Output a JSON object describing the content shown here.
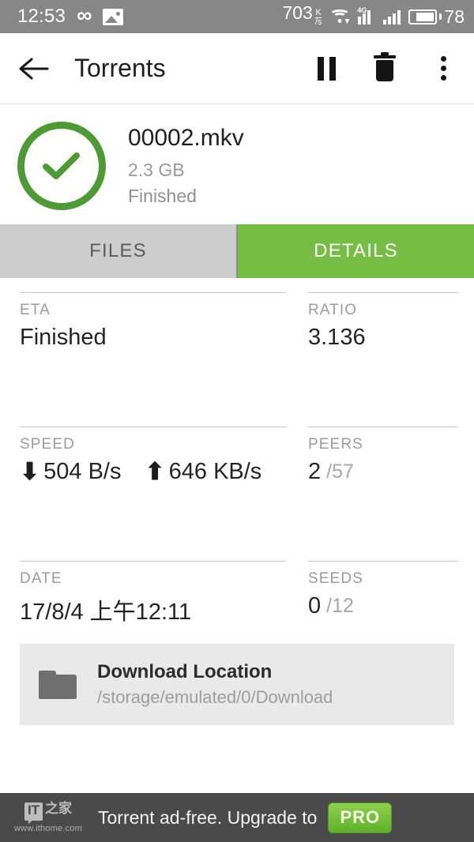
{
  "statusbar": {
    "time": "12:53",
    "infinity_icon": "infinity-icon",
    "image_icon": "image-icon",
    "net_speed": "703",
    "net_speed_unit_top": "K",
    "net_speed_unit_bottom": "/s",
    "wifi_icon": "wifi-download-icon",
    "mobile_label": "4G",
    "battery_level": "78"
  },
  "appbar": {
    "back_icon": "back-arrow-icon",
    "title": "Torrents",
    "pause_icon": "pause-icon",
    "delete_icon": "trash-icon",
    "overflow_icon": "more-vertical-icon"
  },
  "torrent": {
    "progress_percent": 100,
    "status_icon": "check-circle-icon",
    "name": "00002.mkv",
    "size": "2.3 GB",
    "state": "Finished"
  },
  "tabs": [
    {
      "label": "FILES",
      "active": false
    },
    {
      "label": "DETAILS",
      "active": true
    }
  ],
  "details": {
    "eta": {
      "label": "ETA",
      "value": "Finished"
    },
    "ratio": {
      "label": "RATIO",
      "value": "3.136"
    },
    "speed": {
      "label": "SPEED",
      "down_icon": "arrow-down-icon",
      "download": "504 B/s",
      "up_icon": "arrow-up-icon",
      "upload": "646 KB/s"
    },
    "peers": {
      "label": "PEERS",
      "value": "2",
      "total": "/57"
    },
    "date": {
      "label": "DATE",
      "value": "17/8/4 上午12:11"
    },
    "seeds": {
      "label": "SEEDS",
      "value": "0",
      "total": "/12"
    }
  },
  "download_location": {
    "icon": "folder-icon",
    "title": "Download Location",
    "path": "/storage/emulated/0/Download"
  },
  "ad": {
    "watermark_logo": "IT",
    "watermark_cn": "之家",
    "watermark_url": "www.ithome.com",
    "text": "Torrent ad-free. Upgrade to",
    "badge": "PRO"
  },
  "colors": {
    "accent_green": "#76bd43",
    "ring_green": "#4e9a35",
    "statusbar_gray": "#878787",
    "tab_inactive": "#cdcdcd",
    "adbar_gray": "#4a4a4a"
  }
}
